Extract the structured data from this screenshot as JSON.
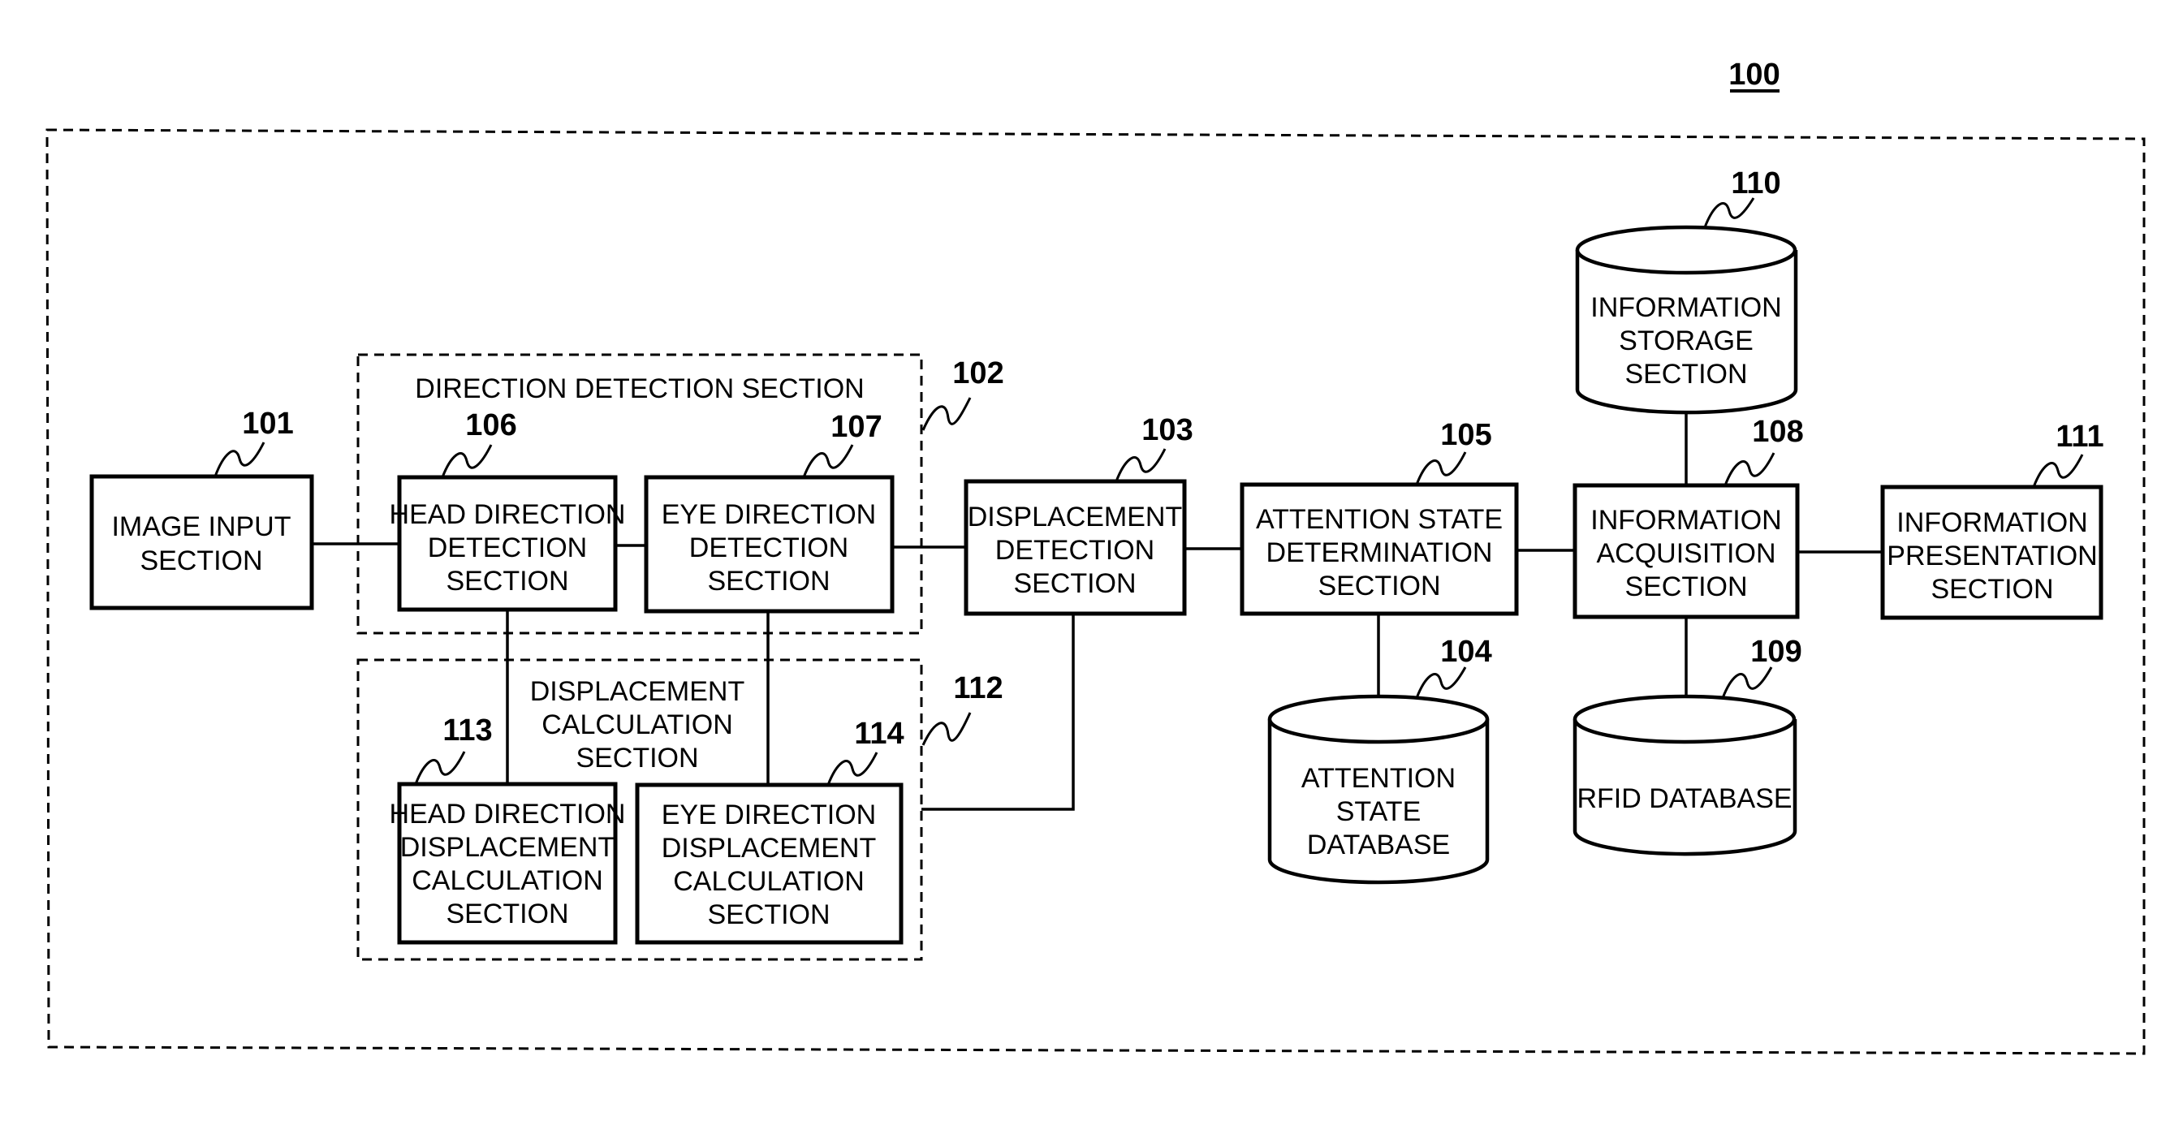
{
  "figure": {
    "reference": "100",
    "groups": {
      "direction_detection": {
        "ref": "102",
        "title": "DIRECTION DETECTION SECTION"
      },
      "displacement_calculation": {
        "ref": "112",
        "title_lines": [
          "DISPLACEMENT",
          "CALCULATION",
          "SECTION"
        ]
      }
    },
    "blocks": {
      "image_input": {
        "ref": "101",
        "lines": [
          "IMAGE INPUT",
          "SECTION"
        ]
      },
      "head_direction_detection": {
        "ref": "106",
        "lines": [
          "HEAD DIRECTION",
          "DETECTION",
          "SECTION"
        ]
      },
      "eye_direction_detection": {
        "ref": "107",
        "lines": [
          "EYE DIRECTION",
          "DETECTION",
          "SECTION"
        ]
      },
      "displacement_detection": {
        "ref": "103",
        "lines": [
          "DISPLACEMENT",
          "DETECTION",
          "SECTION"
        ]
      },
      "attention_state_determination": {
        "ref": "105",
        "lines": [
          "ATTENTION STATE",
          "DETERMINATION",
          "SECTION"
        ]
      },
      "information_acquisition": {
        "ref": "108",
        "lines": [
          "INFORMATION",
          "ACQUISITION",
          "SECTION"
        ]
      },
      "information_presentation": {
        "ref": "111",
        "lines": [
          "INFORMATION",
          "PRESENTATION",
          "SECTION"
        ]
      },
      "head_direction_displacement_calculation": {
        "ref": "113",
        "lines": [
          "HEAD DIRECTION",
          "DISPLACEMENT",
          "CALCULATION",
          "SECTION"
        ]
      },
      "eye_direction_displacement_calculation": {
        "ref": "114",
        "lines": [
          "EYE DIRECTION",
          "DISPLACEMENT",
          "CALCULATION",
          "SECTION"
        ]
      }
    },
    "databases": {
      "information_storage": {
        "ref": "110",
        "lines": [
          "INFORMATION",
          "STORAGE",
          "SECTION"
        ]
      },
      "attention_state_database": {
        "ref": "104",
        "lines": [
          "ATTENTION",
          "STATE",
          "DATABASE"
        ]
      },
      "rfid_database": {
        "ref": "109",
        "lines": [
          "RFID DATABASE"
        ]
      }
    }
  }
}
